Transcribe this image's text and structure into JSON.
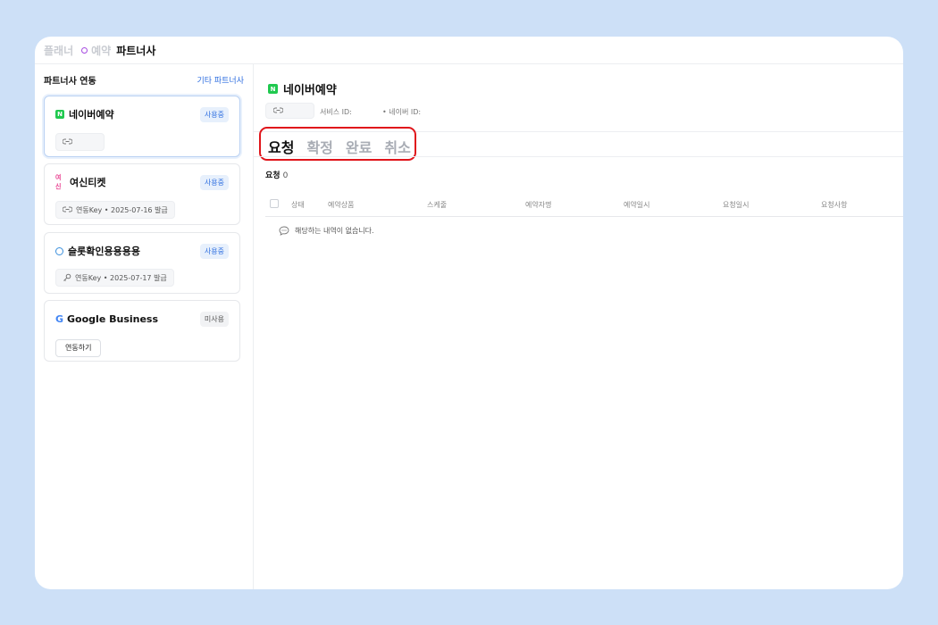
{
  "breadcrumb": {
    "item1": "플래너",
    "item2": "예약",
    "current": "파트너사"
  },
  "sidebar": {
    "title": "파트너사 연동",
    "other_link": "기타 파트너사",
    "cards": [
      {
        "name": "네이버예약",
        "status": "사용중",
        "icon": "naver-icon",
        "chip": ""
      },
      {
        "name": "여신티켓",
        "status": "사용중",
        "icon": "yeoshin-icon",
        "chip": "연동Key • 2025-07-16 발급"
      },
      {
        "name": "슬롯확인용용용용",
        "status": "사용중",
        "icon": "globe-icon",
        "chip": "연동Key • 2025-07-17 발급"
      },
      {
        "name": "Google Business",
        "status": "미사용",
        "icon": "google-icon",
        "button": "연동하기"
      }
    ],
    "yeoshin_logo_text": "여신"
  },
  "main": {
    "title": "네이버예약",
    "service_id_label": "서비스 ID:",
    "naver_id_label": "• 네이버 ID:",
    "tabs": [
      "요청",
      "확정",
      "완료",
      "취소"
    ],
    "count_label": "요청",
    "count_value": "0",
    "columns": [
      "상태",
      "예약상품",
      "스케줄",
      "예약자명",
      "예약일시",
      "요청일시",
      "요청사항"
    ],
    "empty_message": "해당하는 내역이 없습니다."
  },
  "colors": {
    "background": "#cde0f7",
    "accent": "#2f6fe0",
    "highlight": "#e0151b",
    "naver_green": "#20c94f"
  }
}
